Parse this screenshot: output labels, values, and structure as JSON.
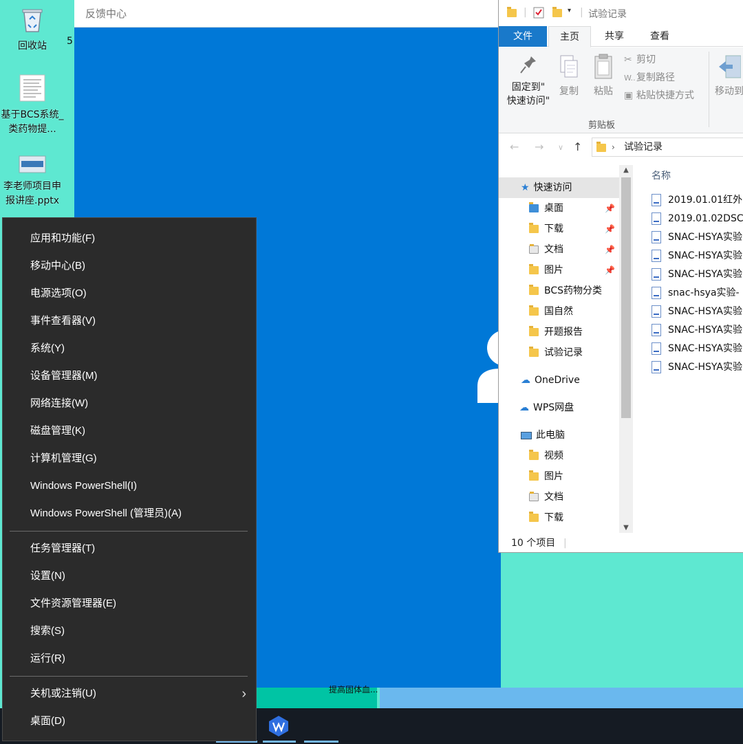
{
  "desktop": {
    "icons": [
      {
        "label": "回收站"
      },
      {
        "label": "基于BCS系统_类药物提..."
      },
      {
        "label": "李老师项目申报讲座.pptx"
      }
    ],
    "partial_text": "5"
  },
  "feedback_hub": {
    "title": "反馈中心"
  },
  "taskbar": {
    "caption": "提高固体血..."
  },
  "winx_menu": {
    "items": [
      "应用和功能(F)",
      "移动中心(B)",
      "电源选项(O)",
      "事件查看器(V)",
      "系统(Y)",
      "设备管理器(M)",
      "网络连接(W)",
      "磁盘管理(K)",
      "计算机管理(G)",
      "Windows PowerShell(I)",
      "Windows PowerShell (管理员)(A)",
      "任务管理器(T)",
      "设置(N)",
      "文件资源管理器(E)",
      "搜索(S)",
      "运行(R)",
      "关机或注销(U)",
      "桌面(D)"
    ]
  },
  "explorer": {
    "title": "试验记录",
    "tabs": {
      "file": "文件",
      "home": "主页",
      "share": "共享",
      "view": "查看"
    },
    "ribbon": {
      "pin_line1": "固定到\"",
      "pin_line2": "快速访问\"",
      "copy": "复制",
      "paste": "粘贴",
      "cut": "剪切",
      "copy_path": "复制路径",
      "paste_shortcut": "粘贴快捷方式",
      "move_to": "移动到",
      "group_clipboard": "剪贴板"
    },
    "address": {
      "current": "试验记录"
    },
    "nav": {
      "quick_access": "快速访问",
      "items": [
        "桌面",
        "下载",
        "文档",
        "图片",
        "BCS药物分类",
        "国自然",
        "开题报告",
        "试验记录"
      ],
      "onedrive": "OneDrive",
      "wps": "WPS网盘",
      "this_pc": "此电脑",
      "pc_items": [
        "视频",
        "图片",
        "文档",
        "下载"
      ]
    },
    "column_name": "名称",
    "files": [
      "2019.01.01红外",
      "2019.01.02DSC",
      "SNAC-HSYA实验",
      "SNAC-HSYA实验",
      "SNAC-HSYA实验",
      "snac-hsya实验-",
      "SNAC-HSYA实验",
      "SNAC-HSYA实验",
      "SNAC-HSYA实验",
      "SNAC-HSYA实验"
    ],
    "status": "10 个项目"
  }
}
